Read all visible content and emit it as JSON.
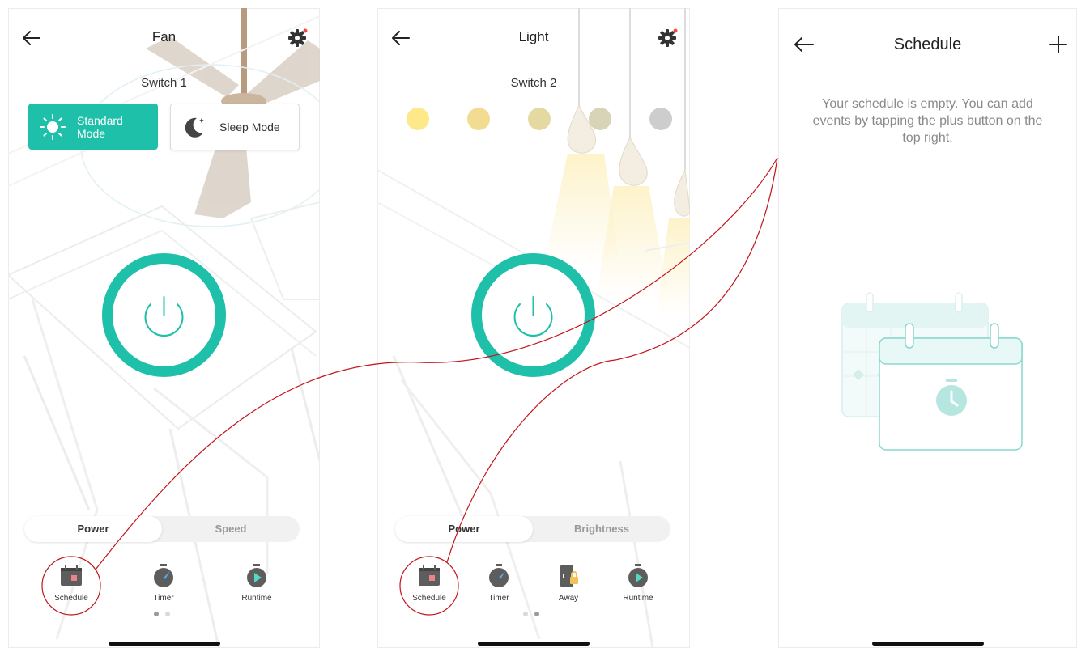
{
  "fan_screen": {
    "title": "Fan",
    "subtitle": "Switch 1",
    "modes": [
      {
        "label": "Standard Mode",
        "active": true
      },
      {
        "label": "Sleep Mode",
        "active": false
      }
    ],
    "tabs": [
      {
        "label": "Power",
        "active": true
      },
      {
        "label": "Speed",
        "active": false
      }
    ],
    "shortcuts": [
      {
        "label": "Schedule",
        "icon": "calendar-icon"
      },
      {
        "label": "Timer",
        "icon": "timer-icon"
      },
      {
        "label": "Runtime",
        "icon": "runtime-icon"
      }
    ],
    "page_indicator": {
      "count": 2,
      "active": 1
    }
  },
  "light_screen": {
    "title": "Light",
    "subtitle": "Switch 2",
    "color_presets": [
      "#fde98a",
      "#f1dc92",
      "#e5d9a2",
      "#d8d4b8",
      "#cdcdcd"
    ],
    "tabs": [
      {
        "label": "Power",
        "active": true
      },
      {
        "label": "Brightness",
        "active": false
      }
    ],
    "shortcuts": [
      {
        "label": "Schedule",
        "icon": "calendar-icon"
      },
      {
        "label": "Timer",
        "icon": "timer-icon"
      },
      {
        "label": "Away",
        "icon": "away-icon"
      },
      {
        "label": "Runtime",
        "icon": "runtime-icon"
      }
    ],
    "page_indicator": {
      "count": 2,
      "active": 2
    }
  },
  "schedule_screen": {
    "title": "Schedule",
    "empty_message": "Your schedule is empty. You can add events by tapping the plus button on the top right."
  },
  "colors": {
    "accent": "#1fc0a9",
    "notification": "#f04a3e",
    "annotation": "#c0161b"
  }
}
